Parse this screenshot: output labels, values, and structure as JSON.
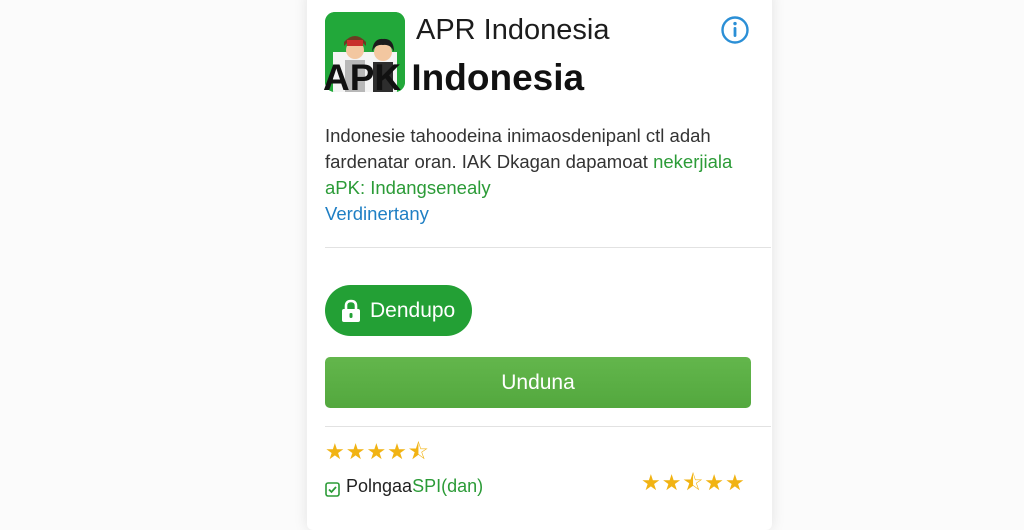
{
  "app": {
    "title_small": "APR Indonesia",
    "title_big": "APK Indonesia"
  },
  "description": {
    "line1": "Indonesie tahoodeina inimaosdenipanl ctl adah",
    "line2_plain": "fardenatar oran. IAK Dkagan dapamoat ",
    "line2_green": "nekerjiala",
    "line3": "aPK: Indangsenealy",
    "line4": "Verdinertany"
  },
  "buttons": {
    "download_pill_label": "Dendupo",
    "download_bar_label": "Unduna"
  },
  "rating": {
    "top_stars": 4.5,
    "bottom_stars": 4.5,
    "top_glyphs": "★★★★⯪",
    "bottom_glyphs": "★★⯪★★"
  },
  "verified": {
    "text_plain": "Polngaa ",
    "text_accent": "SPI(dan)"
  },
  "icons": {
    "app": "app-logo-icon",
    "info": "info-icon",
    "lock": "lock-icon",
    "check": "check-icon",
    "star": "star-icon"
  },
  "colors": {
    "brand_green": "#23a035",
    "bar_green": "#5bb146",
    "link_blue": "#1f7fc4",
    "star_gold": "#f1b313"
  }
}
